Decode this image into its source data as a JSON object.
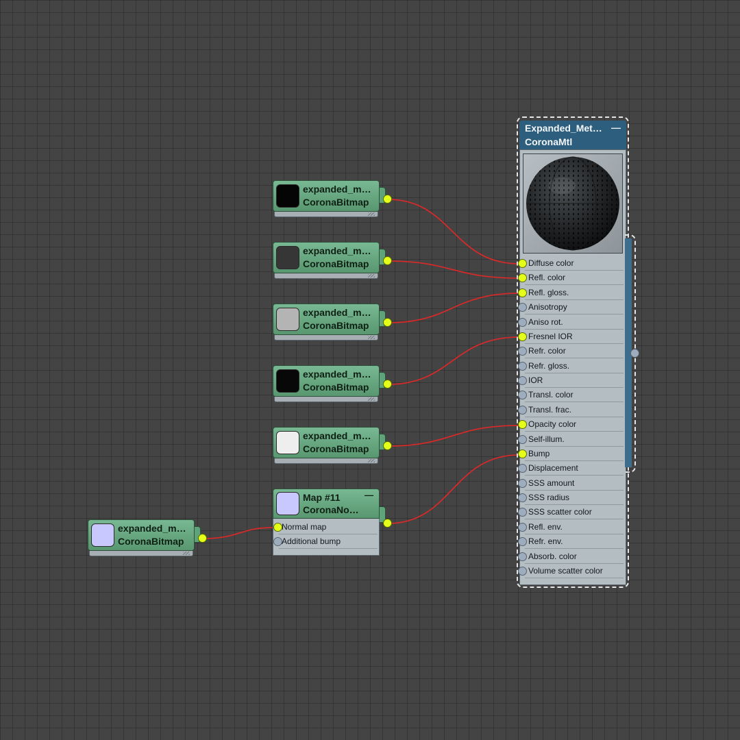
{
  "bitmap_nodes": [
    {
      "name": "expanded_m…",
      "type": "CoronaBitmap",
      "swatch": "#050505"
    },
    {
      "name": "expanded_m…",
      "type": "CoronaBitmap",
      "swatch": "#363636"
    },
    {
      "name": "expanded_m…",
      "type": "CoronaBitmap",
      "swatch": "#b4b4b4"
    },
    {
      "name": "expanded_m…",
      "type": "CoronaBitmap",
      "swatch": "#080808"
    },
    {
      "name": "expanded_m…",
      "type": "CoronaBitmap",
      "swatch": "#eeeeee"
    },
    {
      "name": "expanded_m…",
      "type": "CoronaBitmap",
      "swatch": "#c8c8ff"
    }
  ],
  "normal_node": {
    "name": "Map #11",
    "type": "CoronaNo…",
    "collapse": "—",
    "swatch": "#c8c8ff",
    "slots": [
      {
        "label": "Normal map",
        "connected": true
      },
      {
        "label": "Additional bump",
        "connected": false
      }
    ]
  },
  "material": {
    "name": "Expanded_Met…",
    "type": "CoronaMtl",
    "collapse": "—",
    "slots": [
      {
        "label": "Diffuse color",
        "connected": true
      },
      {
        "label": "Refl. color",
        "connected": true
      },
      {
        "label": "Refl. gloss.",
        "connected": true
      },
      {
        "label": "Anisotropy",
        "connected": false
      },
      {
        "label": "Aniso rot.",
        "connected": false
      },
      {
        "label": "Fresnel IOR",
        "connected": true
      },
      {
        "label": "Refr. color",
        "connected": false
      },
      {
        "label": "Refr. gloss.",
        "connected": false
      },
      {
        "label": "IOR",
        "connected": false
      },
      {
        "label": "Transl. color",
        "connected": false
      },
      {
        "label": "Transl. frac.",
        "connected": false
      },
      {
        "label": "Opacity color",
        "connected": true
      },
      {
        "label": "Self-illum.",
        "connected": false
      },
      {
        "label": "Bump",
        "connected": true
      },
      {
        "label": "Displacement",
        "connected": false
      },
      {
        "label": "SSS amount",
        "connected": false
      },
      {
        "label": "SSS radius",
        "connected": false
      },
      {
        "label": "SSS scatter color",
        "connected": false
      },
      {
        "label": "Refl. env.",
        "connected": false
      },
      {
        "label": "Refr. env.",
        "connected": false
      },
      {
        "label": "Absorb. color",
        "connected": false
      },
      {
        "label": "Volume scatter color",
        "connected": false
      }
    ]
  },
  "colors": {
    "map_node": "#6aaa83",
    "material_header": "#2e5e7d",
    "wire": "#d42a2a",
    "socket_connected": "#e4ff1a",
    "socket_empty": "#9eadbd"
  }
}
